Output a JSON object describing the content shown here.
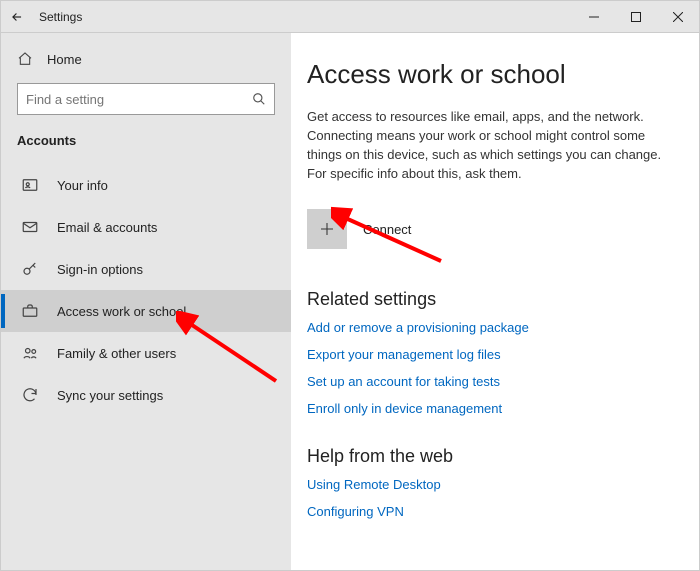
{
  "titlebar": {
    "title": "Settings"
  },
  "sidebar": {
    "home_label": "Home",
    "search_placeholder": "Find a setting",
    "section": "Accounts",
    "items": [
      {
        "label": "Your info"
      },
      {
        "label": "Email & accounts"
      },
      {
        "label": "Sign-in options"
      },
      {
        "label": "Access work or school"
      },
      {
        "label": "Family & other users"
      },
      {
        "label": "Sync your settings"
      }
    ]
  },
  "main": {
    "heading": "Access work or school",
    "description": "Get access to resources like email, apps, and the network. Connecting means your work or school might control some things on this device, such as which settings you can change. For specific info about this, ask them.",
    "connect_label": "Connect",
    "related_heading": "Related settings",
    "related_links": [
      "Add or remove a provisioning package",
      "Export your management log files",
      "Set up an account for taking tests",
      "Enroll only in device management"
    ],
    "help_heading": "Help from the web",
    "help_links": [
      "Using Remote Desktop",
      "Configuring VPN"
    ]
  }
}
